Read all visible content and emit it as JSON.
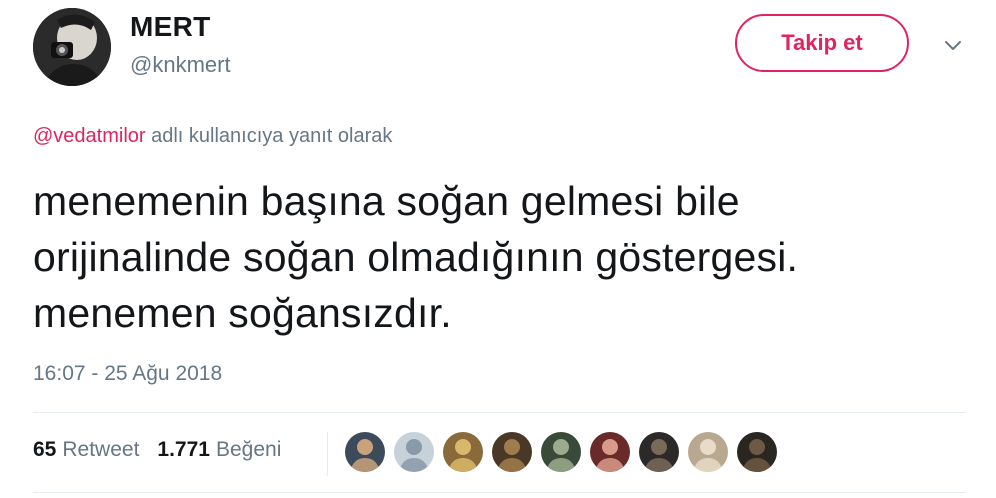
{
  "user": {
    "display_name": "MERT",
    "handle": "@knkmert"
  },
  "follow_button": {
    "label": "Takip et"
  },
  "reply_context": {
    "mention": "@vedatmilor",
    "suffix": " adlı kullanıcıya yanıt olarak"
  },
  "tweet": {
    "lines": [
      "menemenin başına soğan gelmesi bile",
      "orijinalinde soğan olmadığının göstergesi.",
      "menemen soğansızdır."
    ],
    "timestamp": "16:07 - 25 Ağu 2018"
  },
  "stats": {
    "retweets_count": "65",
    "retweets_label": "Retweet",
    "likes_count": "1.771",
    "likes_label": "Beğeni"
  },
  "icons": {
    "more": "chevron-down-icon"
  },
  "colors": {
    "accent": "#e0245e",
    "secondary_text": "#657786",
    "primary_text": "#14171a",
    "divider": "#e6ecf0"
  },
  "liker_avatars": [
    {
      "bg": "#3d4a5c",
      "fg": "#c9a27a"
    },
    {
      "bg": "#c6d1da",
      "fg": "#8a9aa8"
    },
    {
      "bg": "#8a6a3a",
      "fg": "#d8b86a"
    },
    {
      "bg": "#4a3826",
      "fg": "#a07c4c"
    },
    {
      "bg": "#3a4a38",
      "fg": "#9cab8c"
    },
    {
      "bg": "#6a2a2a",
      "fg": "#d99a8a"
    },
    {
      "bg": "#2c2a28",
      "fg": "#7a6a5a"
    },
    {
      "bg": "#b8a890",
      "fg": "#e8dcc8"
    },
    {
      "bg": "#2a2622",
      "fg": "#6e5a44"
    }
  ]
}
